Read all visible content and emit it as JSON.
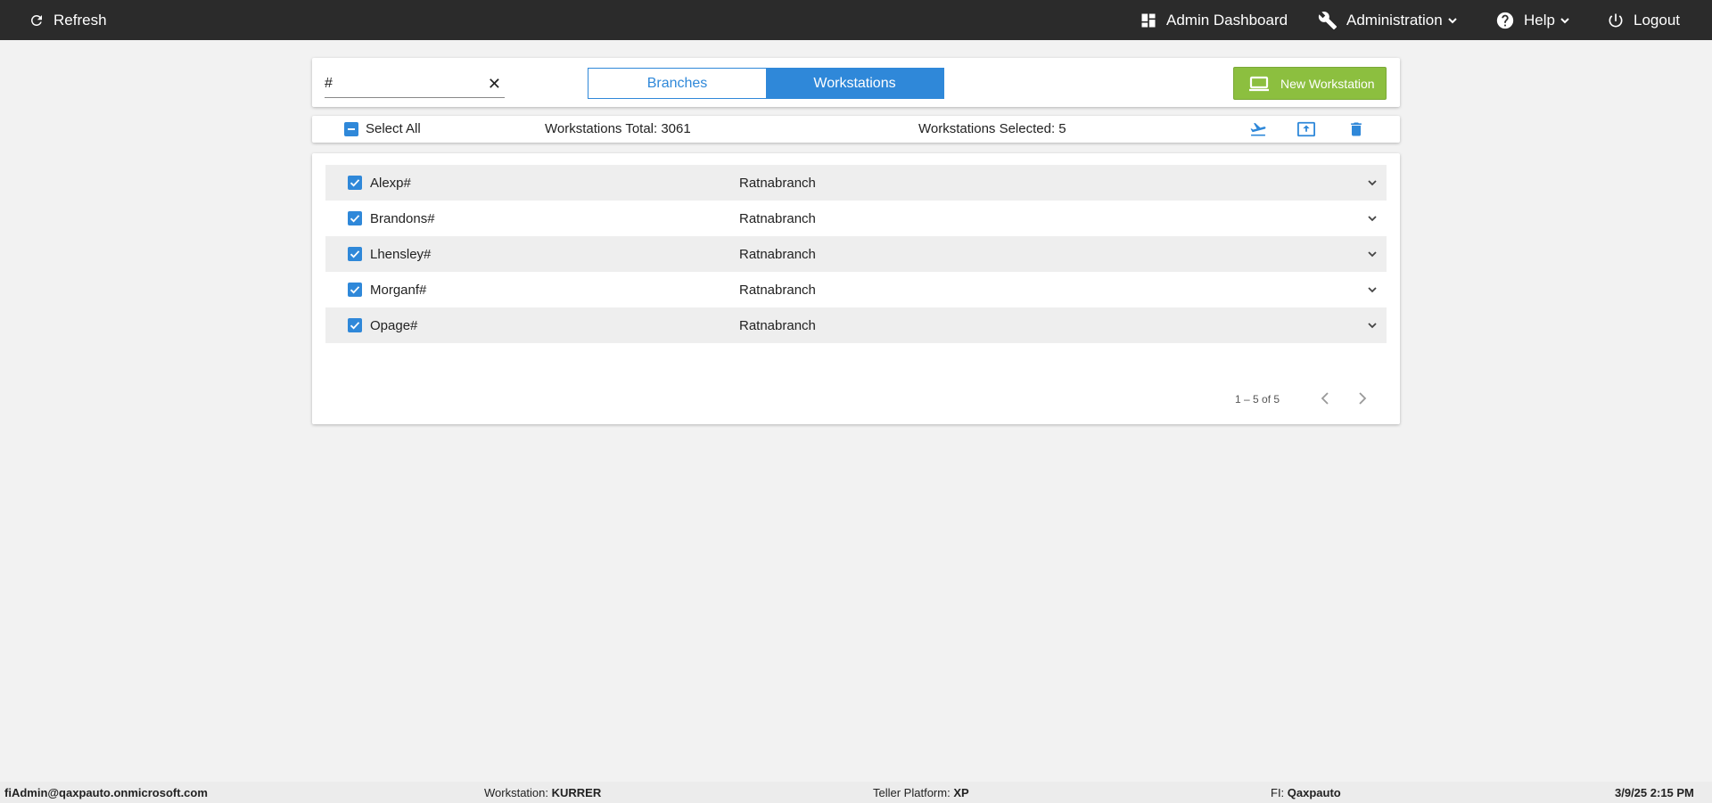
{
  "topbar": {
    "refresh_label": "Refresh",
    "admin_dashboard_label": "Admin Dashboard",
    "administration_label": "Administration",
    "help_label": "Help",
    "logout_label": "Logout"
  },
  "search": {
    "value": "#",
    "placeholder": ""
  },
  "tabs": [
    {
      "label": "Branches",
      "active": false
    },
    {
      "label": "Workstations",
      "active": true
    }
  ],
  "new_workstation_label": "New Workstation",
  "selection": {
    "select_all_label": "Select All",
    "total_text": "Workstations Total: 3061",
    "selected_text": "Workstations Selected: 5"
  },
  "rows": [
    {
      "name": "Alexp#",
      "branch": "Ratnabranch",
      "checked": true
    },
    {
      "name": "Brandons#",
      "branch": "Ratnabranch",
      "checked": true
    },
    {
      "name": "Lhensley#",
      "branch": "Ratnabranch",
      "checked": true
    },
    {
      "name": "Morganf#",
      "branch": "Ratnabranch",
      "checked": true
    },
    {
      "name": "Opage#",
      "branch": "Ratnabranch",
      "checked": true
    }
  ],
  "pager": {
    "text": "1 – 5 of 5"
  },
  "footer": {
    "user": "fiAdmin@qaxpauto.onmicrosoft.com",
    "workstation_label": "Workstation: ",
    "workstation_value": "KURRER",
    "teller_platform_label": "Teller Platform: ",
    "teller_platform_value": "XP",
    "fi_label": "FI: ",
    "fi_value": "Qaxpauto",
    "datetime": "3/9/25 2:15 PM"
  },
  "colors": {
    "accent": "#2f88d9",
    "success": "#8cbf3f",
    "topbar": "#2b2b2b"
  }
}
